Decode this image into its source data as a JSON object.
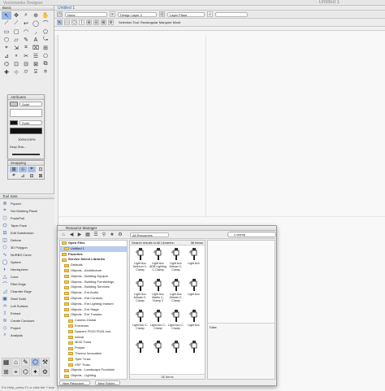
{
  "app": {
    "title": "Vectorworks Designer",
    "doc_title_right": "Untitled 1"
  },
  "basic_palette": {
    "title": "Basic",
    "tools": [
      "↖",
      "✥",
      "⌕",
      "⊕",
      "✋",
      "⟋",
      "⟋",
      "↩",
      "◯",
      "⌒",
      "▭",
      "▢",
      "◠",
      "◞",
      "⬠",
      "⬡",
      "▱",
      "✎",
      "A",
      "⤿",
      "⌖",
      "⇲",
      "⌗",
      "⌧",
      "⊞",
      "⊿",
      "⚬",
      "✂",
      "☰",
      "⎔",
      "⌬",
      "⊡",
      "⊟",
      "⊠",
      "⧉",
      "✚",
      "⊹",
      "⌭",
      "⌻",
      "⍟"
    ]
  },
  "attributes": {
    "title": "Attributes",
    "fill": "Solid",
    "pen": "Solid",
    "opacity": "100%/100%",
    "drop_shadow": "Drop Sha..."
  },
  "snapping": {
    "title": "Snapping",
    "icons": [
      "⊞",
      "⊹",
      "⌖",
      "⊡",
      "⌗",
      "⊿",
      "⊟",
      "⊠"
    ]
  },
  "tool_sets": {
    "title": "Tool Sets",
    "items": [
      {
        "icon": "⊚",
        "label": "Flyover"
      },
      {
        "icon": "⌖",
        "label": "Set Working Plane"
      },
      {
        "icon": "⬡",
        "label": "Push/Pull"
      },
      {
        "icon": "⌬",
        "label": "Taper Face"
      },
      {
        "icon": "⊟",
        "label": "Edit Subdivision"
      },
      {
        "icon": "◫",
        "label": "Deform"
      },
      {
        "icon": "⬠",
        "label": "3D Polygon"
      },
      {
        "icon": "∿",
        "label": "NURBS Curve"
      },
      {
        "icon": "◯",
        "label": "Sphere"
      },
      {
        "icon": "◐",
        "label": "Hemisphere"
      },
      {
        "icon": "△",
        "label": "Cone"
      },
      {
        "icon": "⌒",
        "label": "Fillet Edge"
      },
      {
        "icon": "◿",
        "label": "Chamfer Edge"
      },
      {
        "icon": "▣",
        "label": "Shell Solid"
      },
      {
        "icon": "⌓",
        "label": "Loft Surface"
      },
      {
        "icon": "⇪",
        "label": "Extract"
      },
      {
        "icon": "≋",
        "label": "Create Contours"
      },
      {
        "icon": "◇",
        "label": "Project"
      },
      {
        "icon": "⌕",
        "label": "Analysis"
      }
    ],
    "bottom_icons": [
      "▦",
      "⌂",
      "✎",
      "⬡",
      "⚒",
      "⊞",
      "⌖",
      "⌬",
      "✦",
      "⚙"
    ]
  },
  "status_bar": "For Help, press F1 or click the ? icon.",
  "document": {
    "tab_title": "Untitled 1",
    "class_value": "None",
    "layer_value": "Design Layer-1",
    "layer_list_value": "Layer Plane",
    "mode_text": "Selection Tool: Rectangular Marquee Mode"
  },
  "resource_manager": {
    "title": "Resource Manager",
    "filter": "All Resources",
    "search_value": "c-clamp",
    "tree": [
      {
        "label": "Open Files",
        "hdr": true
      },
      {
        "label": "Untitled 1",
        "sel": true
      },
      {
        "label": "Favorites",
        "hdr": true
      },
      {
        "label": "Service Select Libraries",
        "hdr": true
      },
      {
        "label": "Defaults"
      },
      {
        "label": "Objects - Architecture"
      },
      {
        "label": "Objects - Building Equipm"
      },
      {
        "label": "Objects - Building Furnishings"
      },
      {
        "label": "Objects - Building Services"
      },
      {
        "label": "Objects - Ent Audio"
      },
      {
        "label": "Objects - Ent Controls"
      },
      {
        "label": "Objects - Ent Lighting Instrum"
      },
      {
        "label": "Objects - Ent Stage"
      },
      {
        "label": "Objects - Ent Trusses"
      },
      {
        "label": "Cosmic-Global"
      },
      {
        "label": "Eurotruss"
      },
      {
        "label": "Spacers FD33 FD34.vwx"
      },
      {
        "label": "Interal"
      },
      {
        "label": "MOD Truss"
      },
      {
        "label": "Prolyte"
      },
      {
        "label": "Thermo Innovation"
      },
      {
        "label": "Tyler Truss"
      },
      {
        "label": "XSF Truss"
      },
      {
        "label": "Objects - Landscape Furnishin"
      },
      {
        "label": "Objects - Lighting"
      }
    ],
    "results_header": "Search results in All Libraries:",
    "results_count": "36 Items",
    "items": [
      "Light Acc Selecon C-Clamp",
      "Light Acc ADB Lighting C-Clamp",
      "Light Acc Altman C-Clamp",
      "Light Acc",
      "Light Acc Altman C-Clamp",
      "Light Acc Martin C-Clamp 2",
      "Light Acc Altman C-Clamp",
      "Light Acc",
      "Light Acc C-Clamp",
      "Light Acc C-Clamp",
      "Light Acc C-Clamp",
      "Light Acc",
      "",
      "",
      "",
      ""
    ],
    "footer_count": "36 Items",
    "data_label": "Data",
    "new_resource": "New Resource...",
    "new_folder": "New Folder..."
  }
}
